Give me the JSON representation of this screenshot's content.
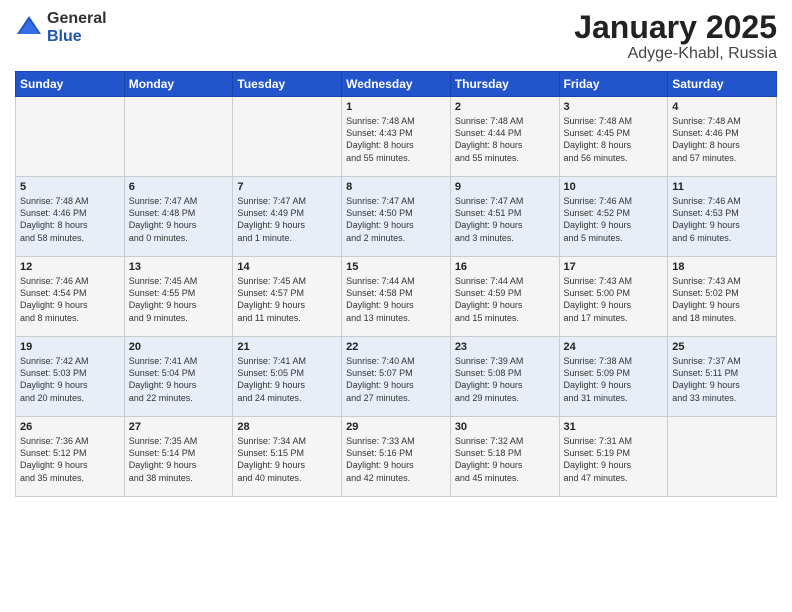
{
  "logo": {
    "general": "General",
    "blue": "Blue"
  },
  "title": {
    "month": "January 2025",
    "location": "Adyge-Khabl, Russia"
  },
  "days_header": [
    "Sunday",
    "Monday",
    "Tuesday",
    "Wednesday",
    "Thursday",
    "Friday",
    "Saturday"
  ],
  "weeks": [
    [
      {
        "day": "",
        "info": ""
      },
      {
        "day": "",
        "info": ""
      },
      {
        "day": "",
        "info": ""
      },
      {
        "day": "1",
        "info": "Sunrise: 7:48 AM\nSunset: 4:43 PM\nDaylight: 8 hours\nand 55 minutes."
      },
      {
        "day": "2",
        "info": "Sunrise: 7:48 AM\nSunset: 4:44 PM\nDaylight: 8 hours\nand 55 minutes."
      },
      {
        "day": "3",
        "info": "Sunrise: 7:48 AM\nSunset: 4:45 PM\nDaylight: 8 hours\nand 56 minutes."
      },
      {
        "day": "4",
        "info": "Sunrise: 7:48 AM\nSunset: 4:46 PM\nDaylight: 8 hours\nand 57 minutes."
      }
    ],
    [
      {
        "day": "5",
        "info": "Sunrise: 7:48 AM\nSunset: 4:46 PM\nDaylight: 8 hours\nand 58 minutes."
      },
      {
        "day": "6",
        "info": "Sunrise: 7:47 AM\nSunset: 4:48 PM\nDaylight: 9 hours\nand 0 minutes."
      },
      {
        "day": "7",
        "info": "Sunrise: 7:47 AM\nSunset: 4:49 PM\nDaylight: 9 hours\nand 1 minute."
      },
      {
        "day": "8",
        "info": "Sunrise: 7:47 AM\nSunset: 4:50 PM\nDaylight: 9 hours\nand 2 minutes."
      },
      {
        "day": "9",
        "info": "Sunrise: 7:47 AM\nSunset: 4:51 PM\nDaylight: 9 hours\nand 3 minutes."
      },
      {
        "day": "10",
        "info": "Sunrise: 7:46 AM\nSunset: 4:52 PM\nDaylight: 9 hours\nand 5 minutes."
      },
      {
        "day": "11",
        "info": "Sunrise: 7:46 AM\nSunset: 4:53 PM\nDaylight: 9 hours\nand 6 minutes."
      }
    ],
    [
      {
        "day": "12",
        "info": "Sunrise: 7:46 AM\nSunset: 4:54 PM\nDaylight: 9 hours\nand 8 minutes."
      },
      {
        "day": "13",
        "info": "Sunrise: 7:45 AM\nSunset: 4:55 PM\nDaylight: 9 hours\nand 9 minutes."
      },
      {
        "day": "14",
        "info": "Sunrise: 7:45 AM\nSunset: 4:57 PM\nDaylight: 9 hours\nand 11 minutes."
      },
      {
        "day": "15",
        "info": "Sunrise: 7:44 AM\nSunset: 4:58 PM\nDaylight: 9 hours\nand 13 minutes."
      },
      {
        "day": "16",
        "info": "Sunrise: 7:44 AM\nSunset: 4:59 PM\nDaylight: 9 hours\nand 15 minutes."
      },
      {
        "day": "17",
        "info": "Sunrise: 7:43 AM\nSunset: 5:00 PM\nDaylight: 9 hours\nand 17 minutes."
      },
      {
        "day": "18",
        "info": "Sunrise: 7:43 AM\nSunset: 5:02 PM\nDaylight: 9 hours\nand 18 minutes."
      }
    ],
    [
      {
        "day": "19",
        "info": "Sunrise: 7:42 AM\nSunset: 5:03 PM\nDaylight: 9 hours\nand 20 minutes."
      },
      {
        "day": "20",
        "info": "Sunrise: 7:41 AM\nSunset: 5:04 PM\nDaylight: 9 hours\nand 22 minutes."
      },
      {
        "day": "21",
        "info": "Sunrise: 7:41 AM\nSunset: 5:05 PM\nDaylight: 9 hours\nand 24 minutes."
      },
      {
        "day": "22",
        "info": "Sunrise: 7:40 AM\nSunset: 5:07 PM\nDaylight: 9 hours\nand 27 minutes."
      },
      {
        "day": "23",
        "info": "Sunrise: 7:39 AM\nSunset: 5:08 PM\nDaylight: 9 hours\nand 29 minutes."
      },
      {
        "day": "24",
        "info": "Sunrise: 7:38 AM\nSunset: 5:09 PM\nDaylight: 9 hours\nand 31 minutes."
      },
      {
        "day": "25",
        "info": "Sunrise: 7:37 AM\nSunset: 5:11 PM\nDaylight: 9 hours\nand 33 minutes."
      }
    ],
    [
      {
        "day": "26",
        "info": "Sunrise: 7:36 AM\nSunset: 5:12 PM\nDaylight: 9 hours\nand 35 minutes."
      },
      {
        "day": "27",
        "info": "Sunrise: 7:35 AM\nSunset: 5:14 PM\nDaylight: 9 hours\nand 38 minutes."
      },
      {
        "day": "28",
        "info": "Sunrise: 7:34 AM\nSunset: 5:15 PM\nDaylight: 9 hours\nand 40 minutes."
      },
      {
        "day": "29",
        "info": "Sunrise: 7:33 AM\nSunset: 5:16 PM\nDaylight: 9 hours\nand 42 minutes."
      },
      {
        "day": "30",
        "info": "Sunrise: 7:32 AM\nSunset: 5:18 PM\nDaylight: 9 hours\nand 45 minutes."
      },
      {
        "day": "31",
        "info": "Sunrise: 7:31 AM\nSunset: 5:19 PM\nDaylight: 9 hours\nand 47 minutes."
      },
      {
        "day": "",
        "info": ""
      }
    ]
  ]
}
